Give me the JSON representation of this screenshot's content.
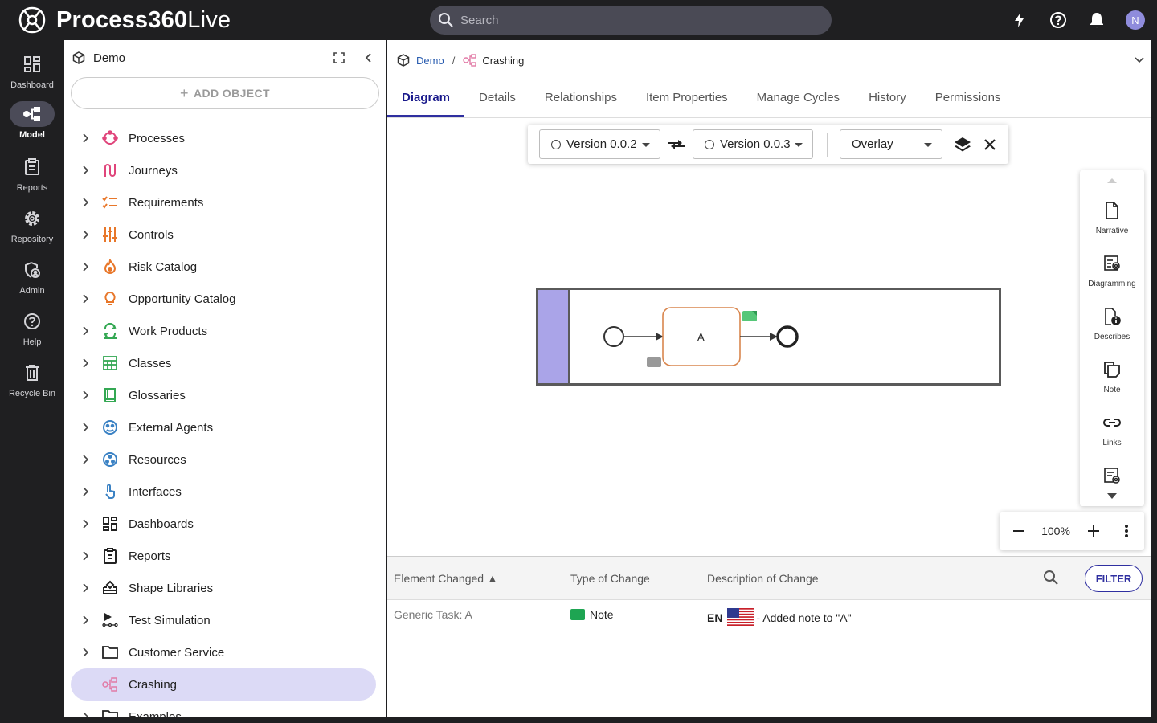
{
  "app": {
    "brand_bold": "Process360",
    "brand_light": "Live",
    "search_placeholder": "Search",
    "user_initial": "N",
    "accent": "#2f2fa0"
  },
  "rail": [
    {
      "label": "Dashboard",
      "icon": "dashboard-icon"
    },
    {
      "label": "Model",
      "icon": "model-icon",
      "active": true
    },
    {
      "label": "Reports",
      "icon": "reports-icon"
    },
    {
      "label": "Repository",
      "icon": "gear-icon"
    },
    {
      "label": "Admin",
      "icon": "admin-shield-icon"
    },
    {
      "label": "Help",
      "icon": "help-icon"
    },
    {
      "label": "Recycle Bin",
      "icon": "trash-icon"
    }
  ],
  "tree": {
    "title": "Demo",
    "add_label": "ADD OBJECT",
    "items": [
      {
        "label": "Processes",
        "icon": "processes-icon"
      },
      {
        "label": "Journeys",
        "icon": "journeys-icon"
      },
      {
        "label": "Requirements",
        "icon": "requirements-icon"
      },
      {
        "label": "Controls",
        "icon": "controls-icon"
      },
      {
        "label": "Risk Catalog",
        "icon": "risk-icon"
      },
      {
        "label": "Opportunity Catalog",
        "icon": "lightbulb-icon"
      },
      {
        "label": "Work Products",
        "icon": "work-products-icon"
      },
      {
        "label": "Classes",
        "icon": "classes-icon"
      },
      {
        "label": "Glossaries",
        "icon": "book-icon"
      },
      {
        "label": "External Agents",
        "icon": "external-agents-icon"
      },
      {
        "label": "Resources",
        "icon": "resources-icon"
      },
      {
        "label": "Interfaces",
        "icon": "interfaces-icon"
      },
      {
        "label": "Dashboards",
        "icon": "dashboard-icon"
      },
      {
        "label": "Reports",
        "icon": "reports-icon"
      },
      {
        "label": "Shape Libraries",
        "icon": "shape-library-icon"
      },
      {
        "label": "Test Simulation",
        "icon": "simulation-icon"
      },
      {
        "label": "Customer Service",
        "icon": "folder-icon"
      },
      {
        "label": "Crashing",
        "icon": "diagram-icon",
        "selected": true
      },
      {
        "label": "Examples",
        "icon": "folder-icon"
      }
    ]
  },
  "breadcrumb": {
    "root": "Demo",
    "current": "Crashing"
  },
  "tabs": [
    "Diagram",
    "Details",
    "Relationships",
    "Item Properties",
    "Manage Cycles",
    "History",
    "Permissions"
  ],
  "compare": {
    "left_version": "Version 0.0.2",
    "right_version": "Version 0.0.3",
    "mode": "Overlay"
  },
  "diagram": {
    "task_label": "A"
  },
  "side_tools": [
    "Narrative",
    "Diagramming",
    "Describes",
    "Note",
    "Links"
  ],
  "zoom": {
    "value": "100%"
  },
  "changes": {
    "headers": {
      "element": "Element Changed",
      "type": "Type of Change",
      "description": "Description of Change"
    },
    "filter_label": "FILTER",
    "rows": [
      {
        "element": "Generic Task: A",
        "type": "Note",
        "lang": "EN",
        "description": "- Added note to \"A\""
      }
    ]
  }
}
